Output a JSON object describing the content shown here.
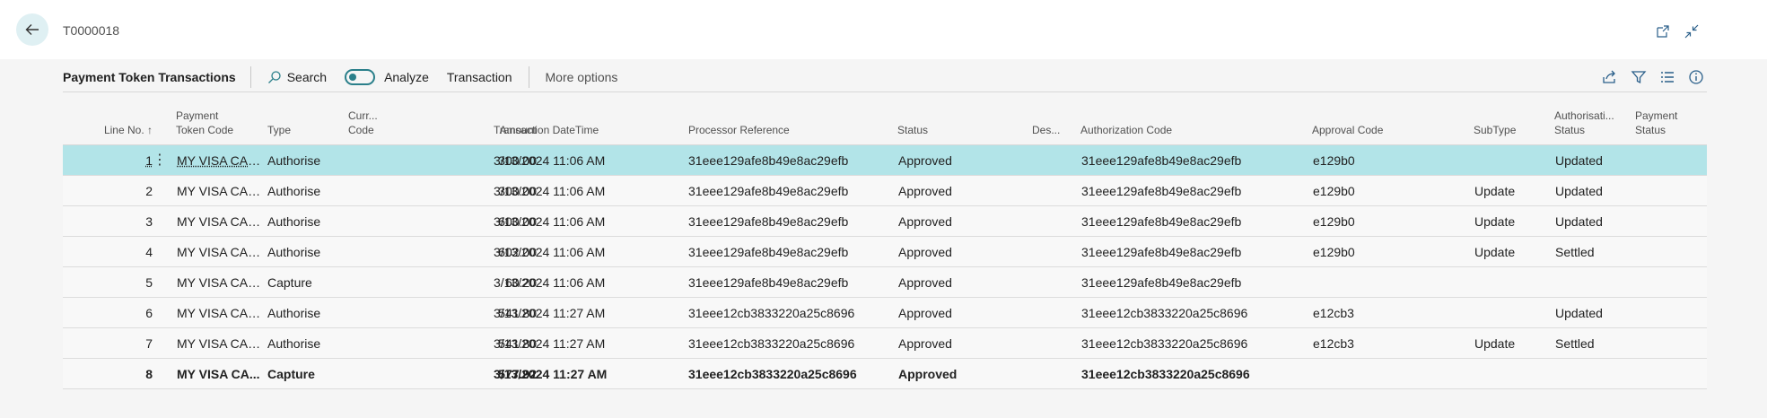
{
  "header": {
    "title": "T0000018"
  },
  "actionbar": {
    "title": "Payment Token Transactions",
    "search_label": "Search",
    "analyze_label": "Analyze",
    "transaction_label": "Transaction",
    "more_label": "More options"
  },
  "columns": {
    "line_no": "Line No.",
    "line_no_sort": "↑",
    "payment_token_code_1": "Payment",
    "payment_token_code_2": "Token Code",
    "type": "Type",
    "curr_code_1": "Curr...",
    "curr_code_2": "Code",
    "amount": "Amount",
    "datetime": "Transaction DateTime",
    "processor_ref": "Processor Reference",
    "status": "Status",
    "des": "Des...",
    "auth_code": "Authorization Code",
    "approval_code": "Approval Code",
    "subtype": "SubType",
    "auth_status_1": "Authorisati...",
    "auth_status_2": "Status",
    "payment_status_1": "Payment",
    "payment_status_2": "Status"
  },
  "rows": [
    {
      "line": "1",
      "token": "MY VISA CARD",
      "type": "Authorise",
      "curr": "",
      "amount": "300.00",
      "datetime": "3/13/2024 11:06 AM",
      "processor_ref": "31eee129afe8b49e8ac29efb",
      "status": "Approved",
      "des": "",
      "auth_code": "31eee129afe8b49e8ac29efb",
      "approval_code": "e129b0",
      "subtype": "",
      "auth_status": "Updated",
      "payment_status": ""
    },
    {
      "line": "2",
      "token": "MY VISA CARD",
      "type": "Authorise",
      "curr": "",
      "amount": "300.00",
      "datetime": "3/13/2024 11:06 AM",
      "processor_ref": "31eee129afe8b49e8ac29efb",
      "status": "Approved",
      "des": "",
      "auth_code": "31eee129afe8b49e8ac29efb",
      "approval_code": "e129b0",
      "subtype": "Update",
      "auth_status": "Updated",
      "payment_status": ""
    },
    {
      "line": "3",
      "token": "MY VISA CARD",
      "type": "Authorise",
      "curr": "",
      "amount": "600.00",
      "datetime": "3/13/2024 11:06 AM",
      "processor_ref": "31eee129afe8b49e8ac29efb",
      "status": "Approved",
      "des": "",
      "auth_code": "31eee129afe8b49e8ac29efb",
      "approval_code": "e129b0",
      "subtype": "Update",
      "auth_status": "Updated",
      "payment_status": ""
    },
    {
      "line": "4",
      "token": "MY VISA CARD",
      "type": "Authorise",
      "curr": "",
      "amount": "602.00",
      "datetime": "3/13/2024 11:06 AM",
      "processor_ref": "31eee129afe8b49e8ac29efb",
      "status": "Approved",
      "des": "",
      "auth_code": "31eee129afe8b49e8ac29efb",
      "approval_code": "e129b0",
      "subtype": "Update",
      "auth_status": "Settled",
      "payment_status": ""
    },
    {
      "line": "5",
      "token": "MY VISA CARD",
      "type": "Capture",
      "curr": "",
      "amount": "60.20",
      "datetime": "3/13/2024 11:06 AM",
      "processor_ref": "31eee129afe8b49e8ac29efb",
      "status": "Approved",
      "des": "",
      "auth_code": "31eee129afe8b49e8ac29efb",
      "approval_code": "",
      "subtype": "",
      "auth_status": "",
      "payment_status": ""
    },
    {
      "line": "6",
      "token": "MY VISA CARD",
      "type": "Authorise",
      "curr": "",
      "amount": "541.80",
      "datetime": "3/13/2024 11:27 AM",
      "processor_ref": "31eee12cb3833220a25c8696",
      "status": "Approved",
      "des": "",
      "auth_code": "31eee12cb3833220a25c8696",
      "approval_code": "e12cb3",
      "subtype": "",
      "auth_status": "Updated",
      "payment_status": ""
    },
    {
      "line": "7",
      "token": "MY VISA CARD",
      "type": "Authorise",
      "curr": "",
      "amount": "541.80",
      "datetime": "3/13/2024 11:27 AM",
      "processor_ref": "31eee12cb3833220a25c8696",
      "status": "Approved",
      "des": "",
      "auth_code": "31eee12cb3833220a25c8696",
      "approval_code": "e12cb3",
      "subtype": "Update",
      "auth_status": "Settled",
      "payment_status": ""
    },
    {
      "line": "8",
      "token": "MY VISA CA...",
      "type": "Capture",
      "curr": "",
      "amount": "577.92",
      "datetime": "3/13/2024 11:27 AM",
      "processor_ref": "31eee12cb3833220a25c8696",
      "status": "Approved",
      "des": "",
      "auth_code": "31eee12cb3833220a25c8696",
      "approval_code": "",
      "subtype": "",
      "auth_status": "",
      "payment_status": ""
    }
  ],
  "row_menu_glyph": "⋮",
  "icons": [
    "back-arrow-icon",
    "open-new-window-icon",
    "collapse-icon",
    "search-icon",
    "share-icon",
    "filter-icon",
    "list-view-icon",
    "info-icon"
  ],
  "colors": {
    "selected_row": "#b2e4e8",
    "accent": "#2a7f8a",
    "back_button": "#dff0f3"
  }
}
